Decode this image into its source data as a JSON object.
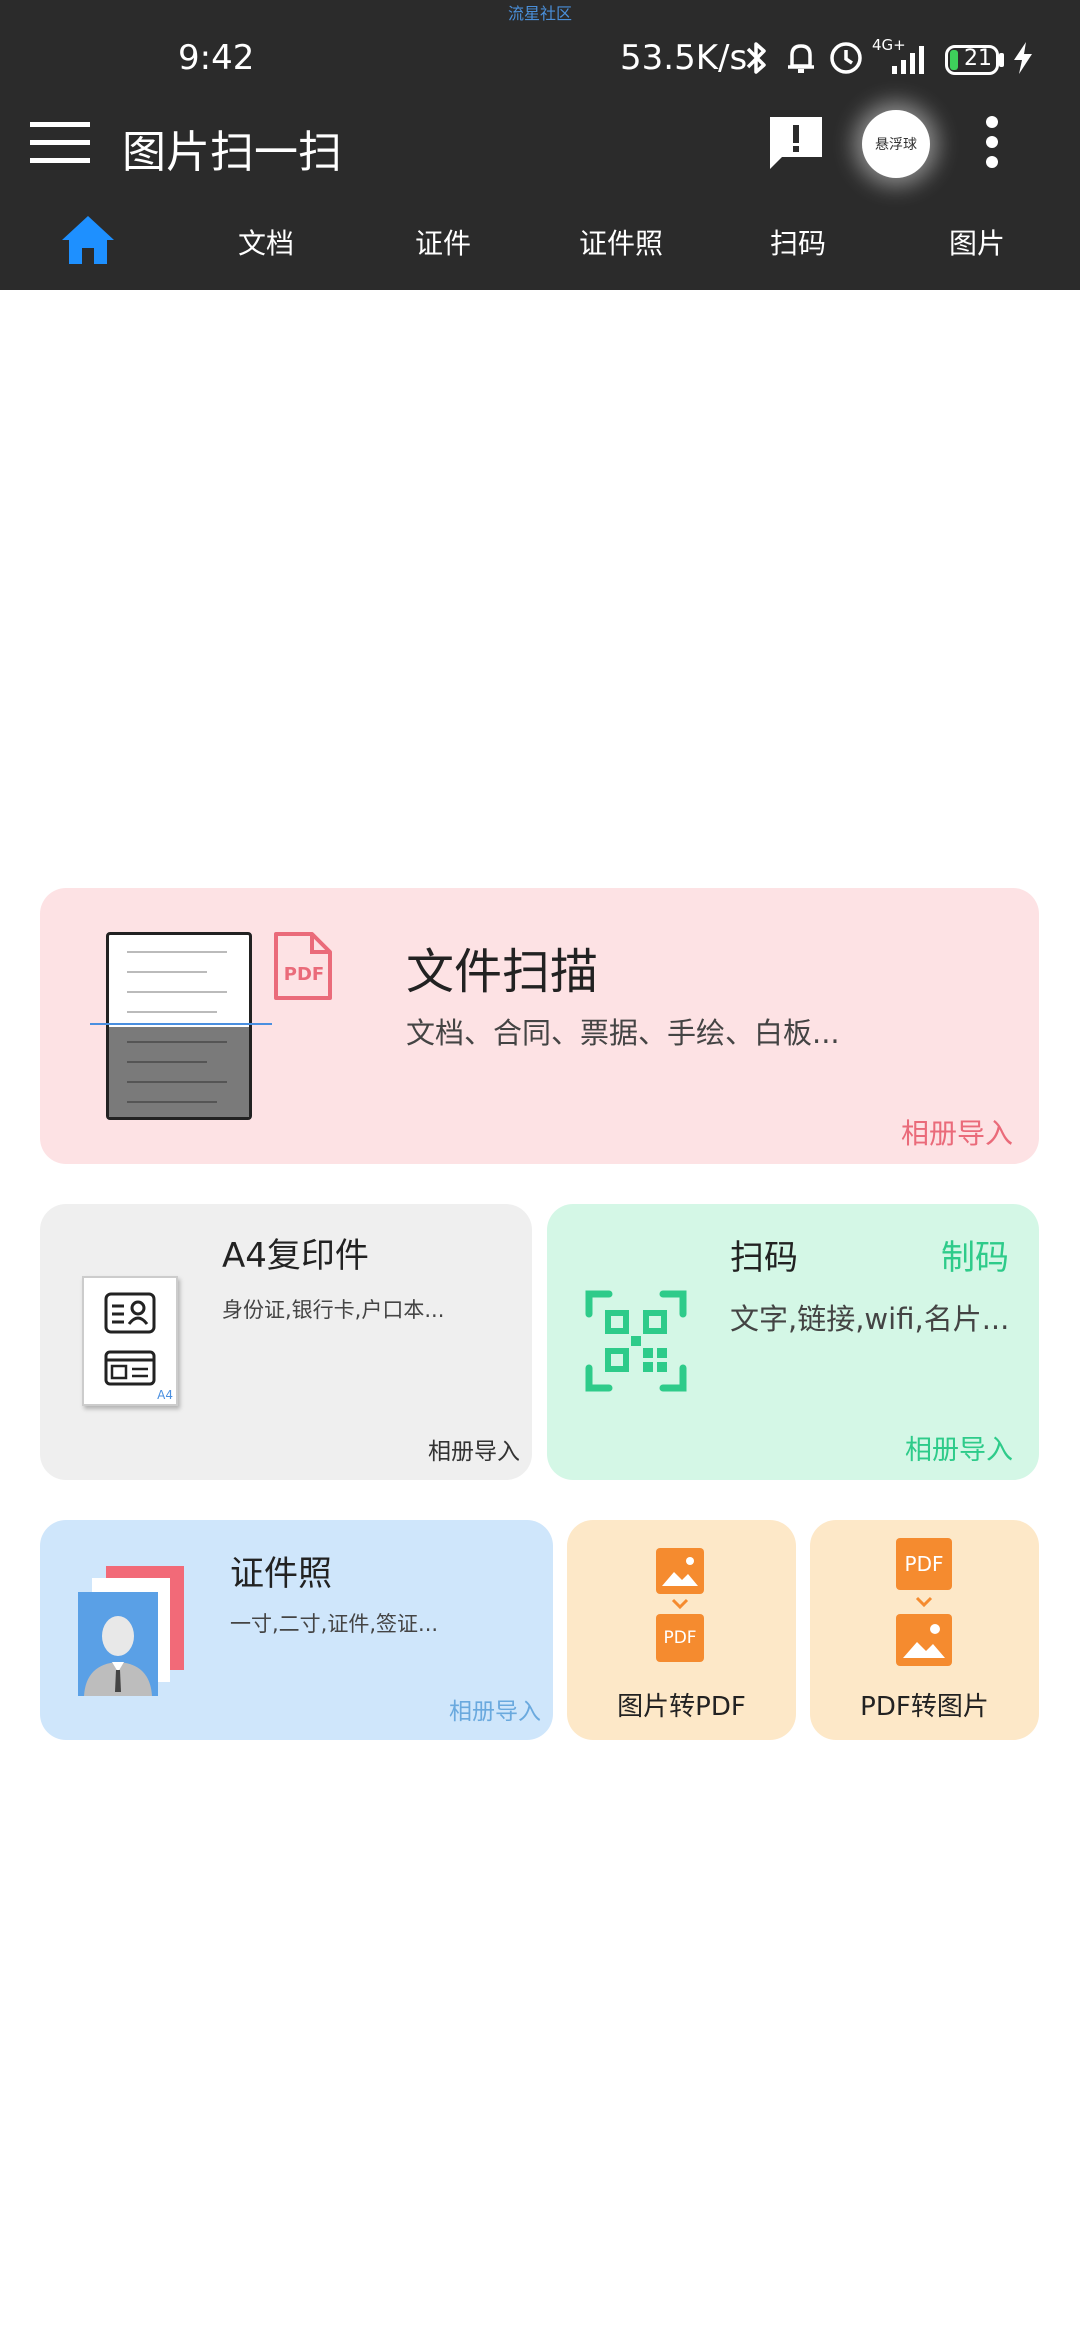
{
  "status": {
    "watermark": "流星社区",
    "time": "9:42",
    "net_speed": "53.5K/s",
    "signal_type": "4G+",
    "battery": "21"
  },
  "appbar": {
    "title": "图片扫一扫",
    "float_ball_label": "悬浮球"
  },
  "tabs": [
    {
      "label": "文档"
    },
    {
      "label": "证件"
    },
    {
      "label": "证件照"
    },
    {
      "label": "扫码"
    },
    {
      "label": "图片"
    }
  ],
  "cards": {
    "file_scan": {
      "title": "文件扫描",
      "subtitle": "文档、合同、票据、手绘、白板...",
      "link": "相册导入",
      "pdf_label": "PDF"
    },
    "a4_copy": {
      "title": "A4复印件",
      "subtitle": "身份证,银行卡,户口本...",
      "link": "相册导入",
      "paper_label": "A4"
    },
    "scan_code": {
      "title": "扫码",
      "make_code": "制码",
      "subtitle": "文字,链接,wifi,名片...",
      "link": "相册导入"
    },
    "id_photo": {
      "title": "证件照",
      "subtitle": "一寸,二寸,证件,签证...",
      "link": "相册导入"
    },
    "img_to_pdf": {
      "label": "图片转PDF",
      "pdf_label": "PDF"
    },
    "pdf_to_img": {
      "label": "PDF转图片",
      "pdf_label": "PDF"
    }
  },
  "colors": {
    "topbar": "#2b2b2b",
    "home_blue": "#1e90ff",
    "card_pink": "#fde2e4",
    "pink_accent": "#ea6b7a",
    "card_gray": "#efefef",
    "card_green": "#d4f7e6",
    "green_accent": "#2ecb8a",
    "card_blue": "#cfe6fb",
    "blue_accent": "#6aa9de",
    "card_orange": "#fde8c8",
    "orange_accent": "#f58b2f"
  }
}
